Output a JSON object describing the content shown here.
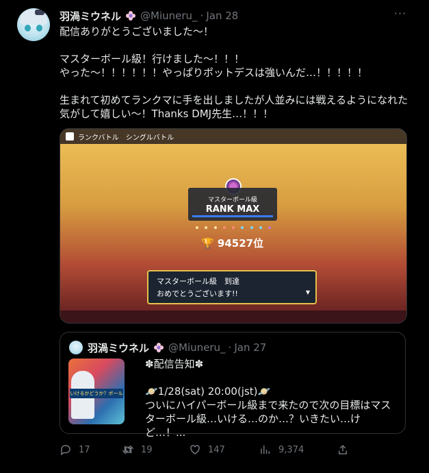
{
  "tweet": {
    "author_name": "羽渦ミウネル",
    "handle": "@Miuneru_",
    "separator": "·",
    "date": "Jan 28",
    "more_label": "···",
    "text": "配信ありがとうございました〜！\n\nマスターボール級！行けました〜！！！\nやった〜！！！！！！やっぱりポットデスは強いんだ…！！！！！\n\n生まれて初めてランクマに手を出しましたが人並みには戦えるようになれた気がして嬉しい〜！Thanks DMJ先生…！！！"
  },
  "media": {
    "topbar_label": "ランクバトル　シングルバトル",
    "rank_sub": "マスターボール級",
    "rank_title": "RANK MAX",
    "score": "94527位",
    "dialog_line1": "マスターボール級　到達",
    "dialog_line2": "おめでとうございます!!",
    "dialog_arrow": "▼"
  },
  "quote": {
    "author_name": "羽渦ミウネル",
    "handle": "@Miuneru_",
    "separator": "·",
    "date": "Jan 27",
    "thumb_banner": "いけるかどうか？ボール",
    "text": "✽配信告知✽\n\n🪐1/28(sat) 20:00(jst)🪐\nついにハイパーボール級まで来たので次の目標はマスターボール級…いける…のか…？いきたい…けど…！..."
  },
  "actions": {
    "replies": "17",
    "retweets": "19",
    "likes": "147",
    "views": "9,374"
  },
  "colors": {
    "background": "#000000",
    "text": "#e7e9ea",
    "muted": "#71767b",
    "border": "#2f3336"
  },
  "icons": [
    "reply-icon",
    "retweet-icon",
    "like-icon",
    "views-icon",
    "share-icon",
    "more-icon",
    "flower-badge-icon"
  ]
}
